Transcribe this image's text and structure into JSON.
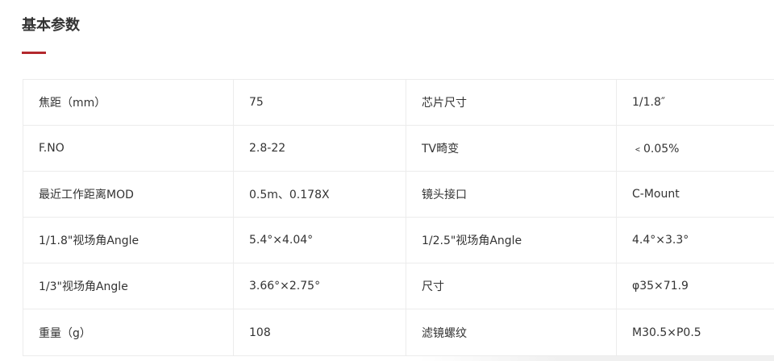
{
  "section": {
    "title": "基本参数",
    "accent_color": "#b3282d"
  },
  "specs": {
    "rows": [
      {
        "label1": "焦距（mm）",
        "value1": "75",
        "label2": "芯片尺寸",
        "value2": "1/1.8″"
      },
      {
        "label1": "F.NO",
        "value1": "2.8-22",
        "label2": "TV畸变",
        "value2": "﹤0.05%"
      },
      {
        "label1": "最近工作距离MOD",
        "value1": "0.5m、0.178X",
        "label2": "镜头接口",
        "value2": "C-Mount"
      },
      {
        "label1": "1/1.8\"视场角Angle",
        "value1": "5.4°×4.04°",
        "label2": "1/2.5\"视场角Angle",
        "value2": "4.4°×3.3°"
      },
      {
        "label1": "1/3\"视场角Angle",
        "value1": "3.66°×2.75°",
        "label2": "尺寸",
        "value2": "φ35×71.9"
      },
      {
        "label1": "重量（g）",
        "value1": "108",
        "label2": "滤镜螺纹",
        "value2": "M30.5×P0.5"
      }
    ]
  }
}
